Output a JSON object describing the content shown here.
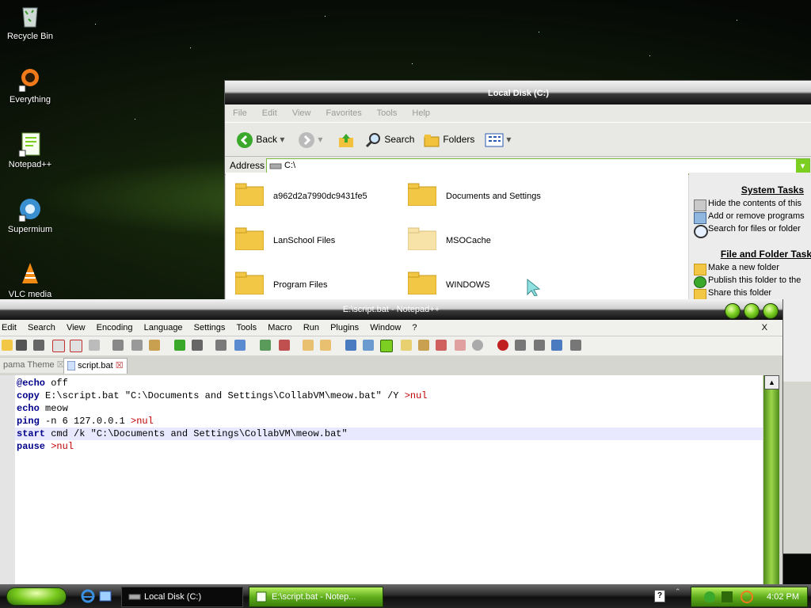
{
  "desktop": {
    "icons": [
      {
        "label": "Recycle Bin"
      },
      {
        "label": "Everything"
      },
      {
        "label": "Notepad++"
      },
      {
        "label": "Supermium"
      },
      {
        "label": "VLC media"
      }
    ]
  },
  "explorer": {
    "title": "Local Disk (C:)",
    "menu": [
      "File",
      "Edit",
      "View",
      "Favorites",
      "Tools",
      "Help"
    ],
    "toolbar": {
      "back": "Back",
      "search": "Search",
      "folders": "Folders"
    },
    "address": {
      "label": "Address",
      "value": "C:\\"
    },
    "folders": [
      {
        "name": "a962d2a7990dc9431fe5"
      },
      {
        "name": "Documents and Settings"
      },
      {
        "name": "LanSchool Files"
      },
      {
        "name": "MSOCache"
      },
      {
        "name": "Program Files"
      },
      {
        "name": "WINDOWS"
      }
    ],
    "tasks": {
      "system_heading": "System Tasks",
      "system_items": [
        "Hide the contents of this",
        "Add or remove programs",
        "Search for files or folder"
      ],
      "file_heading": "File and Folder Task",
      "file_items": [
        "Make a new folder",
        "Publish this folder to the",
        "Share this folder"
      ]
    }
  },
  "notepad": {
    "title": "E:\\script.bat - Notepad++",
    "menu": [
      "Edit",
      "Search",
      "View",
      "Encoding",
      "Language",
      "Settings",
      "Tools",
      "Macro",
      "Run",
      "Plugins",
      "Window",
      "?"
    ],
    "close_x": "X",
    "tabs": [
      {
        "label": "pama Theme"
      },
      {
        "label": "script.bat"
      }
    ],
    "code": [
      {
        "kw": "@echo",
        "rest": " off"
      },
      {
        "kw": "copy",
        "rest": " E:\\script.bat \"C:\\Documents and Settings\\CollabVM\\meow.bat\" /Y ",
        "op": ">nul"
      },
      {
        "kw": "echo",
        "rest": " meow"
      },
      {
        "kw": "ping",
        "rest": " -n 6 127.0.0.1 ",
        "op": ">nul"
      },
      {
        "kw": "start",
        "rest": " cmd /k \"C:\\Documents and Settings\\CollabVM\\meow.bat\""
      },
      {
        "kw": "pause",
        "rest": " ",
        "op": ">nul"
      }
    ]
  },
  "taskbar": {
    "tasks": [
      {
        "label": "Local Disk (C:)"
      },
      {
        "label": "E:\\script.bat - Notep..."
      }
    ],
    "clock": "4:02 PM"
  },
  "colors": {
    "accent": "#7ccf20",
    "keyword": "#00008b",
    "redirect": "#c00000"
  }
}
